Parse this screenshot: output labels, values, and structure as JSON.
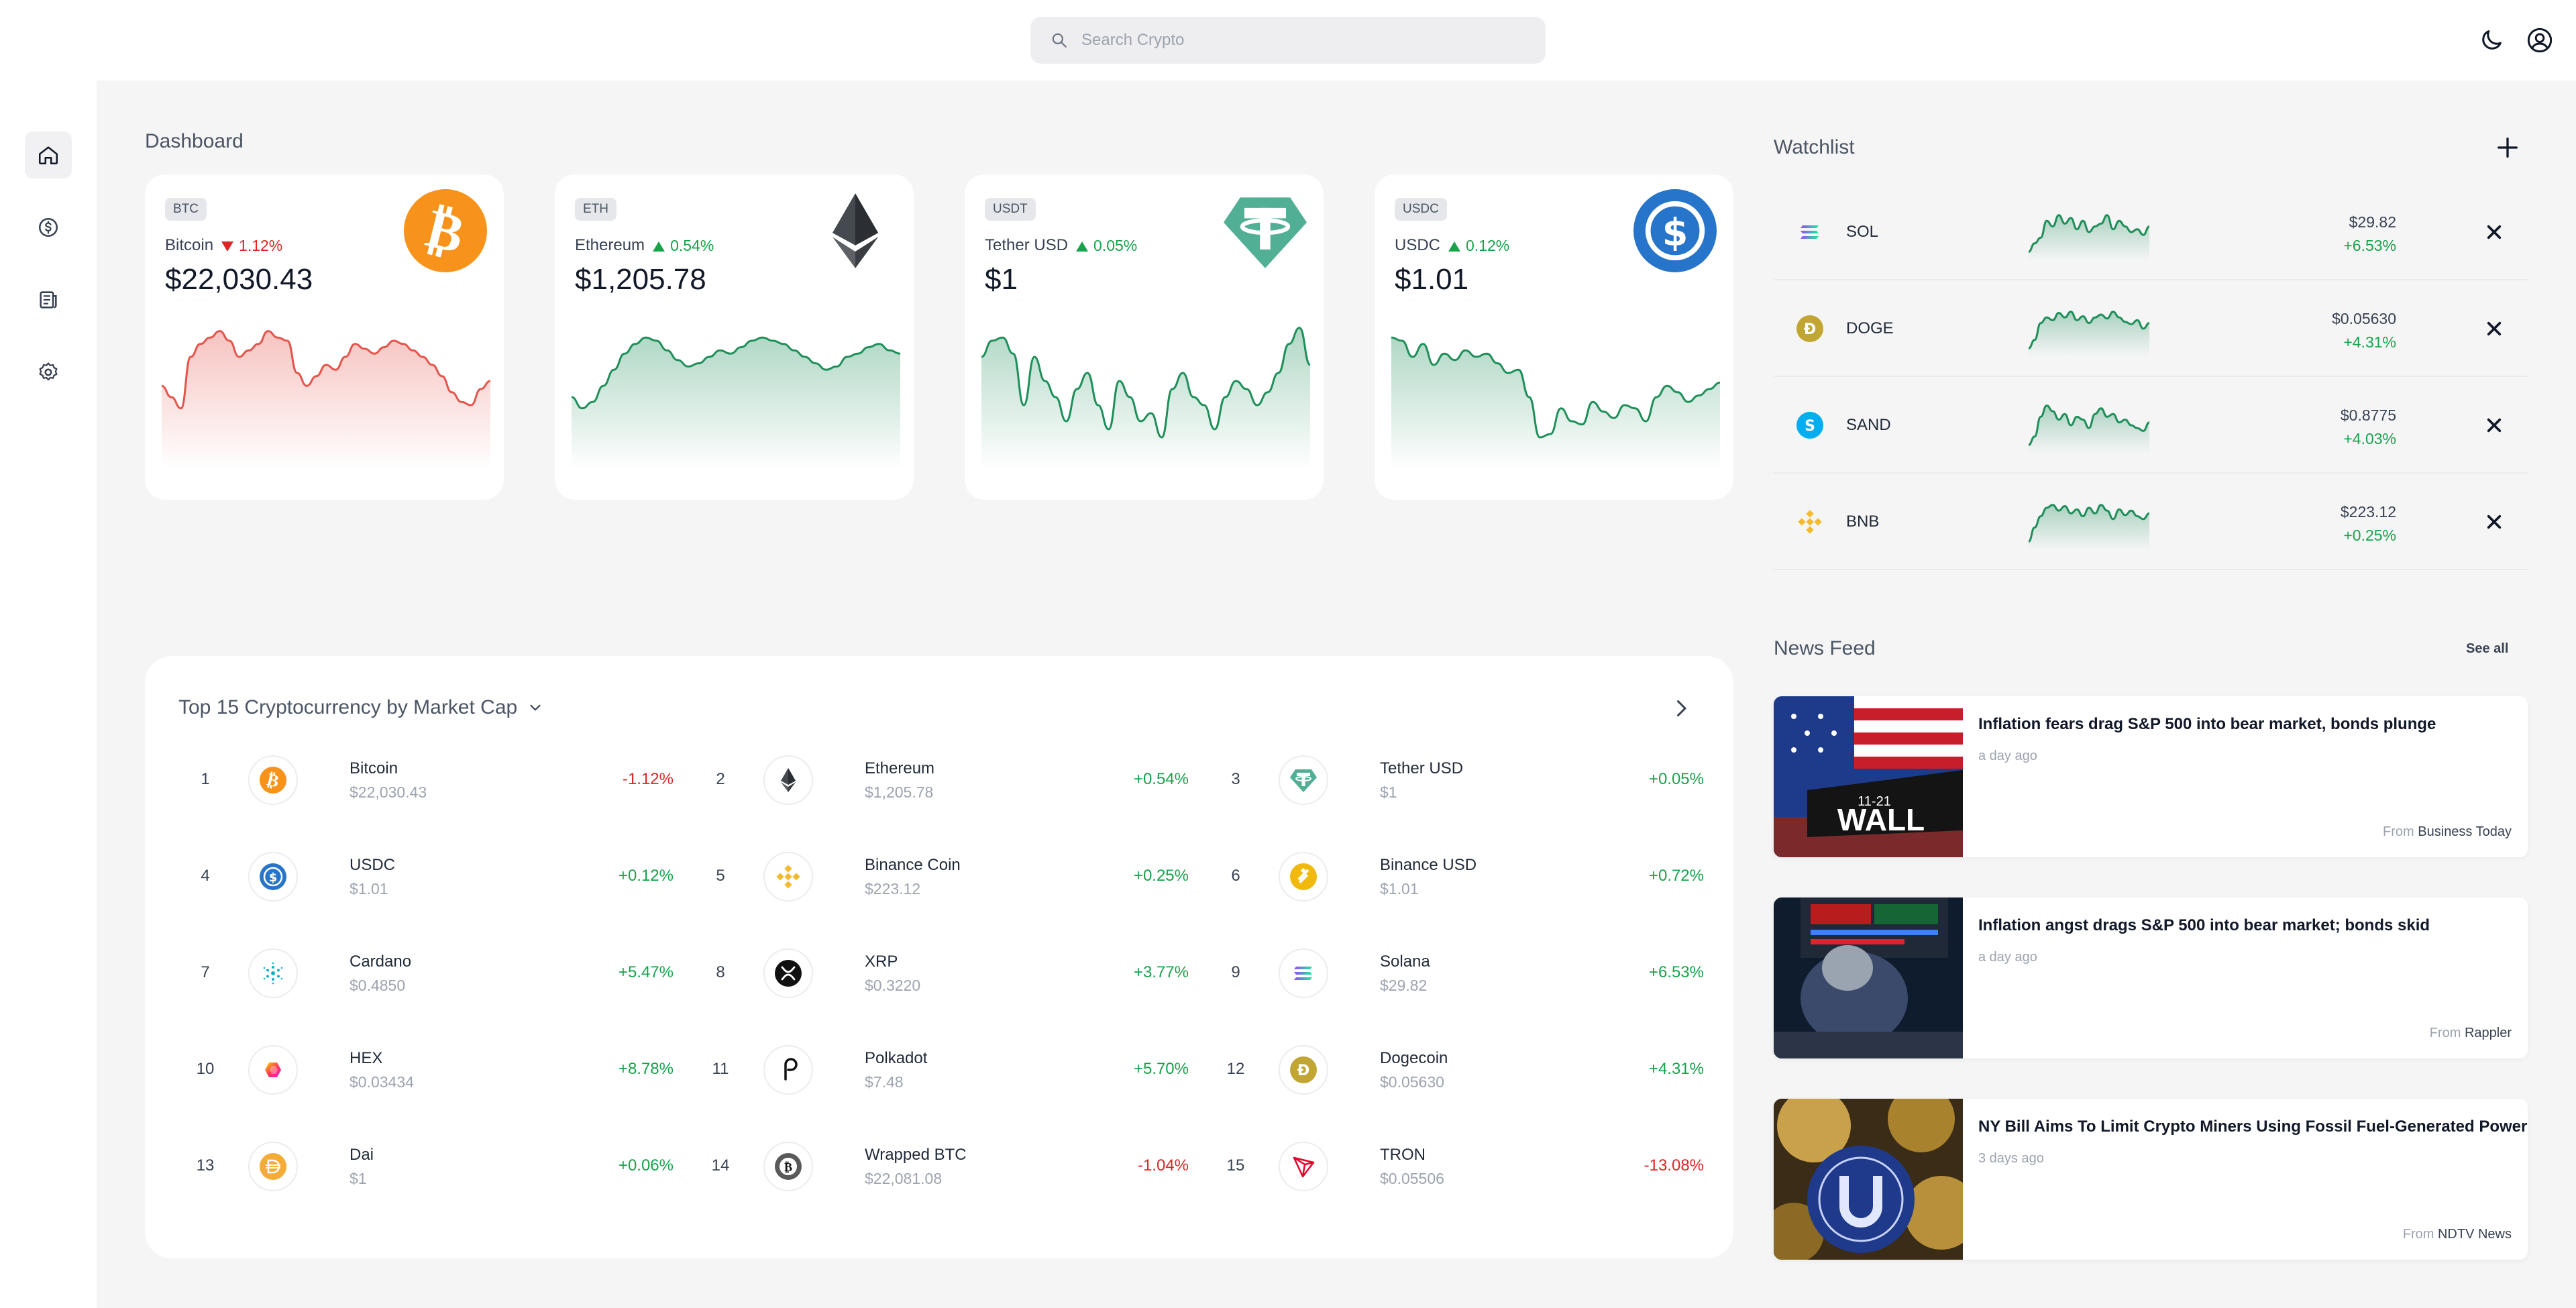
{
  "search": {
    "placeholder": "Search Crypto"
  },
  "sidebar": {
    "items": [
      {
        "name": "home-icon"
      },
      {
        "name": "dollar-icon"
      },
      {
        "name": "news-icon"
      },
      {
        "name": "settings-icon"
      }
    ]
  },
  "dashboard": {
    "title": "Dashboard",
    "cards": [
      {
        "tag": "BTC",
        "name": "Bitcoin",
        "change": "1.12%",
        "direction": "down",
        "price": "$22,030.43",
        "color": "#e5544b",
        "spark": [
          48,
          55,
          62,
          30,
          22,
          18,
          14,
          20,
          30,
          26,
          22,
          14,
          18,
          20,
          40,
          48,
          42,
          35,
          38,
          30,
          22,
          25,
          28,
          24,
          20,
          22,
          26,
          30,
          35,
          42,
          52,
          58,
          60,
          50,
          45
        ]
      },
      {
        "tag": "ETH",
        "name": "Ethereum",
        "change": "0.54%",
        "direction": "up",
        "price": "$1,205.78",
        "color": "#1f8f5a",
        "spark": [
          55,
          62,
          58,
          48,
          38,
          28,
          22,
          18,
          20,
          26,
          32,
          36,
          34,
          30,
          26,
          28,
          24,
          20,
          18,
          20,
          22,
          26,
          30,
          34,
          38,
          36,
          30,
          28,
          24,
          22,
          26,
          28
        ]
      },
      {
        "tag": "USDT",
        "name": "Tether USD",
        "change": "0.05%",
        "direction": "up",
        "price": "$1",
        "color": "#1f8f5a",
        "spark": [
          30,
          20,
          18,
          28,
          60,
          30,
          45,
          55,
          70,
          50,
          40,
          60,
          75,
          45,
          55,
          70,
          65,
          80,
          50,
          40,
          55,
          60,
          75,
          55,
          45,
          50,
          60,
          52,
          40,
          22,
          12,
          35
        ]
      },
      {
        "tag": "USDC",
        "name": "USDC",
        "change": "0.12%",
        "direction": "up",
        "price": "$1.01",
        "color": "#1f8f5a",
        "spark": [
          18,
          20,
          30,
          22,
          35,
          28,
          32,
          26,
          30,
          28,
          34,
          40,
          38,
          55,
          80,
          78,
          62,
          70,
          72,
          58,
          64,
          68,
          60,
          62,
          70,
          55,
          48,
          52,
          58,
          54,
          50,
          46
        ]
      }
    ]
  },
  "watchlist": {
    "title": "Watchlist",
    "items": [
      {
        "symbol": "SOL",
        "price": "$29.82",
        "change": "+6.53%"
      },
      {
        "symbol": "DOGE",
        "price": "$0.05630",
        "change": "+4.31%"
      },
      {
        "symbol": "SAND",
        "price": "$0.8775",
        "change": "+4.03%"
      },
      {
        "symbol": "BNB",
        "price": "$223.12",
        "change": "+0.25%"
      }
    ]
  },
  "top": {
    "title": "Top 15 Cryptocurrency by Market Cap",
    "coins": [
      {
        "rank": "1",
        "name": "Bitcoin",
        "price": "$22,030.43",
        "change": "-1.12%"
      },
      {
        "rank": "2",
        "name": "Ethereum",
        "price": "$1,205.78",
        "change": "+0.54%"
      },
      {
        "rank": "3",
        "name": "Tether USD",
        "price": "$1",
        "change": "+0.05%"
      },
      {
        "rank": "4",
        "name": "USDC",
        "price": "$1.01",
        "change": "+0.12%"
      },
      {
        "rank": "5",
        "name": "Binance Coin",
        "price": "$223.12",
        "change": "+0.25%"
      },
      {
        "rank": "6",
        "name": "Binance USD",
        "price": "$1.01",
        "change": "+0.72%"
      },
      {
        "rank": "7",
        "name": "Cardano",
        "price": "$0.4850",
        "change": "+5.47%"
      },
      {
        "rank": "8",
        "name": "XRP",
        "price": "$0.3220",
        "change": "+3.77%"
      },
      {
        "rank": "9",
        "name": "Solana",
        "price": "$29.82",
        "change": "+6.53%"
      },
      {
        "rank": "10",
        "name": "HEX",
        "price": "$0.03434",
        "change": "+8.78%"
      },
      {
        "rank": "11",
        "name": "Polkadot",
        "price": "$7.48",
        "change": "+5.70%"
      },
      {
        "rank": "12",
        "name": "Dogecoin",
        "price": "$0.05630",
        "change": "+4.31%"
      },
      {
        "rank": "13",
        "name": "Dai",
        "price": "$1",
        "change": "+0.06%"
      },
      {
        "rank": "14",
        "name": "Wrapped BTC",
        "price": "$22,081.08",
        "change": "-1.04%"
      },
      {
        "rank": "15",
        "name": "TRON",
        "price": "$0.05506",
        "change": "-13.08%"
      }
    ]
  },
  "news": {
    "title": "News Feed",
    "see_all": "See all",
    "from_label": "From",
    "items": [
      {
        "headline": "Inflation fears drag S&P 500 into bear market, bonds plunge",
        "ago": "a day ago",
        "source": "Business Today",
        "img_text": "WALL",
        "img_text2": "11-21"
      },
      {
        "headline": "Inflation angst drags S&P 500 into bear market; bonds skid",
        "ago": "a day ago",
        "source": "Rappler"
      },
      {
        "headline": "NY Bill Aims To Limit Crypto Miners Using Fossil Fuel-Generated Power",
        "ago": "3 days ago",
        "source": "NDTV News"
      }
    ]
  }
}
